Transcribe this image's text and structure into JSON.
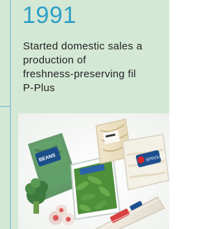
{
  "year": "1991",
  "description_lines": [
    "Started domestic sales a",
    "production of",
    "freshness-preserving fil",
    "P-Plus"
  ],
  "colors": {
    "background": "#d4e8d6",
    "accent": "#2e9fc6",
    "rule": "#9ccbcf",
    "text": "#222222"
  },
  "photo": {
    "subject": "packaged fresh produce in P-Plus film",
    "package_labels": [
      "Fresh Beans",
      "Bean Sprouts"
    ]
  }
}
